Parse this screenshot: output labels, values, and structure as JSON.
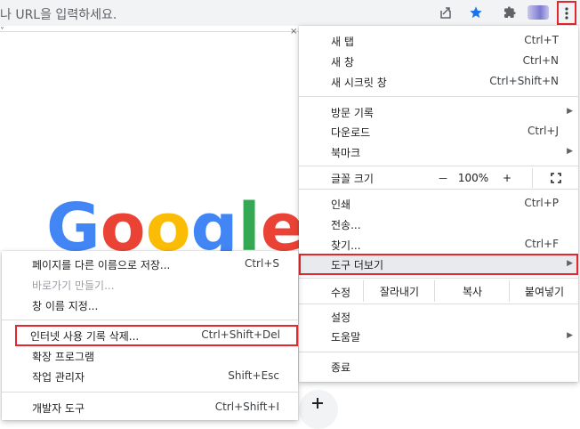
{
  "toolbar": {
    "omnibox_text": "나 URL을 입력하세요.",
    "icons": [
      "share-icon",
      "bookmark-star-icon",
      "extensions-icon",
      "profile-avatar",
      "more-vert-icon"
    ],
    "accent": "#1a73e8"
  },
  "page": {
    "logo_text": "Google",
    "logo_colors": [
      "#4285f4",
      "#ea4335",
      "#fbbc05",
      "#4285f4",
      "#34a853",
      "#ea4335"
    ]
  },
  "menu": {
    "new_tab": {
      "label": "새 탭",
      "shortcut": "Ctrl+T"
    },
    "new_window": {
      "label": "새 창",
      "shortcut": "Ctrl+N"
    },
    "new_incognito": {
      "label": "새 시크릿 창",
      "shortcut": "Ctrl+Shift+N"
    },
    "history": {
      "label": "방문 기록"
    },
    "downloads": {
      "label": "다운로드",
      "shortcut": "Ctrl+J"
    },
    "bookmarks": {
      "label": "북마크"
    },
    "zoom": {
      "label": "글꼴 크기",
      "minus": "－",
      "value": "100%",
      "plus": "+"
    },
    "print": {
      "label": "인쇄",
      "shortcut": "Ctrl+P"
    },
    "cast": {
      "label": "전송..."
    },
    "find": {
      "label": "찾기...",
      "shortcut": "Ctrl+F"
    },
    "more_tools": {
      "label": "도구 더보기"
    },
    "edit": {
      "label": "수정",
      "cut": "잘라내기",
      "copy": "복사",
      "paste": "붙여넣기"
    },
    "settings": {
      "label": "설정"
    },
    "help": {
      "label": "도움말"
    },
    "exit": {
      "label": "종료"
    }
  },
  "submenu": {
    "save_page": {
      "label": "페이지를 다른 이름으로 저장...",
      "shortcut": "Ctrl+S"
    },
    "create_shortcut": {
      "label": "바로가기 만들기..."
    },
    "name_window": {
      "label": "창 이름 지정..."
    },
    "clear_data": {
      "label": "인터넷 사용 기록 삭제...",
      "shortcut": "Ctrl+Shift+Del"
    },
    "extensions": {
      "label": "확장 프로그램"
    },
    "task_manager": {
      "label": "작업 관리자",
      "shortcut": "Shift+Esc"
    },
    "dev_tools": {
      "label": "개발자 도구",
      "shortcut": "Ctrl+Shift+I"
    }
  },
  "highlight_color": "#e3262f"
}
